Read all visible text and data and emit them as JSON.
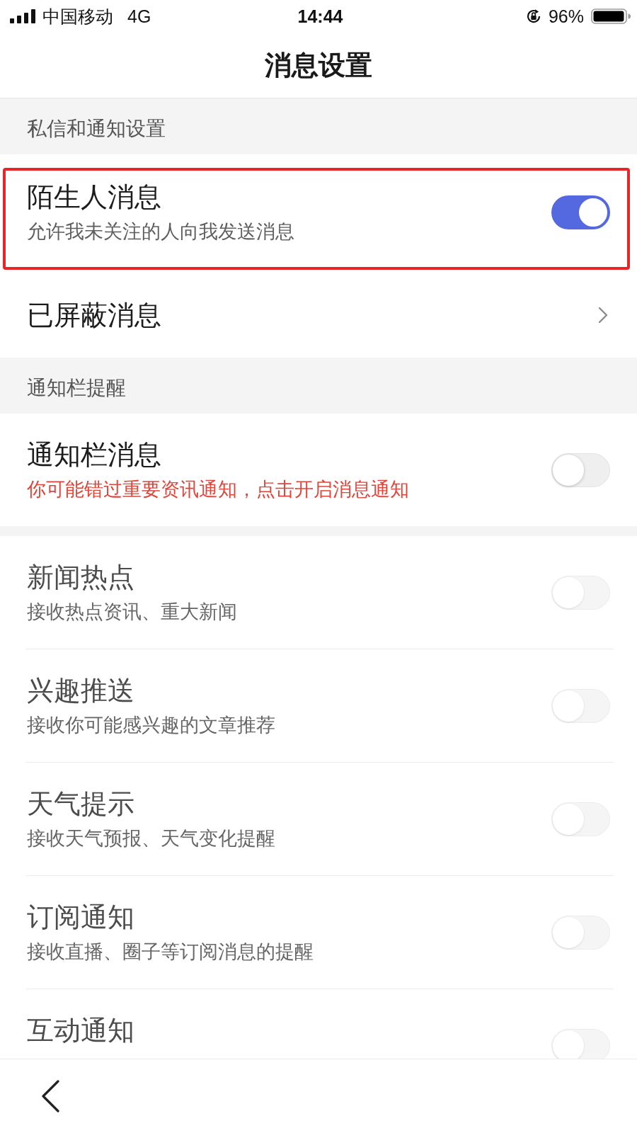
{
  "status_bar": {
    "carrier": "中国移动",
    "network": "4G",
    "time": "14:44",
    "battery": "96%"
  },
  "nav_bar": {
    "title": "消息设置"
  },
  "sections": [
    {
      "header": "私信和通知设置",
      "dividers": false,
      "items": [
        {
          "kind": "toggle",
          "title": "陌生人消息",
          "subtitle": "允许我未关注的人向我发送消息",
          "alert": false,
          "on": true,
          "disabled": false,
          "highlighted": true
        },
        {
          "kind": "link",
          "title": "已屏蔽消息",
          "disabled": false,
          "highlighted": false
        }
      ]
    },
    {
      "header": "通知栏提醒",
      "items": [
        {
          "kind": "toggle",
          "title": "通知栏消息",
          "subtitle": "你可能错过重要资讯通知，点击开启消息通知",
          "alert": true,
          "on": false,
          "disabled": false,
          "highlighted": false
        }
      ]
    },
    {
      "dividers": true,
      "items": [
        {
          "kind": "toggle",
          "title": "新闻热点",
          "subtitle": "接收热点资讯、重大新闻",
          "alert": false,
          "on": false,
          "disabled": true,
          "highlighted": false
        },
        {
          "kind": "toggle",
          "title": "兴趣推送",
          "subtitle": "接收你可能感兴趣的文章推荐",
          "alert": false,
          "on": false,
          "disabled": true,
          "highlighted": false
        },
        {
          "kind": "toggle",
          "title": "天气提示",
          "subtitle": "接收天气预报、天气变化提醒",
          "alert": false,
          "on": false,
          "disabled": true,
          "highlighted": false
        },
        {
          "kind": "toggle",
          "title": "订阅通知",
          "subtitle": "接收直播、圈子等订阅消息的提醒",
          "alert": false,
          "on": false,
          "disabled": true,
          "highlighted": false
        },
        {
          "kind": "toggle",
          "title": "互动通知",
          "on": false,
          "disabled": true,
          "highlighted": false
        }
      ]
    }
  ]
}
